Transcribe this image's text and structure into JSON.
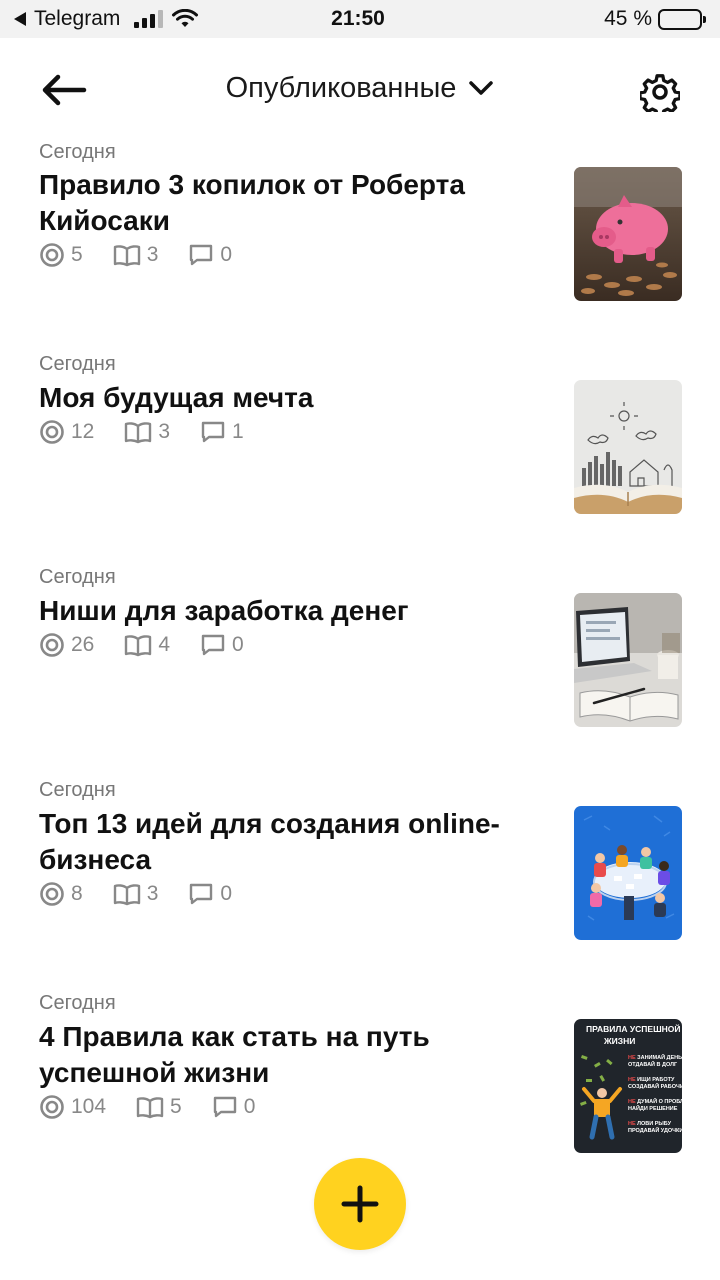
{
  "status_bar": {
    "back_app": "Telegram",
    "time": "21:50",
    "battery": "45 %",
    "battery_level": 0.45
  },
  "header": {
    "title": "Опубликованные"
  },
  "articles": [
    {
      "date": "Сегодня",
      "title": "Правило 3 копилок от Роберта Кийосаки",
      "views": "5",
      "reads": "3",
      "comments": "0",
      "thumb": "piggy-bank-image"
    },
    {
      "date": "Сегодня",
      "title": "Моя будущая мечта",
      "views": "12",
      "reads": "3",
      "comments": "1",
      "thumb": "book-sketch-image"
    },
    {
      "date": "Сегодня",
      "title": "Ниши для заработка денег",
      "views": "26",
      "reads": "4",
      "comments": "0",
      "thumb": "laptop-desk-image"
    },
    {
      "date": "Сегодня",
      "title": "Топ 13 идей для создания online-бизнеса",
      "views": "8",
      "reads": "3",
      "comments": "0",
      "thumb": "team-meeting-image"
    },
    {
      "date": "Сегодня",
      "title": "4 Правила как стать на путь успешной жизни",
      "views": "104",
      "reads": "5",
      "comments": "0",
      "thumb": "success-rules-image",
      "thumb_text": {
        "heading": "ПРАВИЛА УСПЕШНОЙ ЖИЗНИ",
        "lines": [
          "НЕ ЗАНИМАЙ ДЕНЬГИ ОТДАВАЙ В ДОЛГ",
          "НЕ ИЩИ РАБОТУ СОЗДАВАЙ РАБОЧИЕ",
          "НЕ ДУМАЙ О ПРОБЛЕМАХ НАЙДИ РЕШЕНИЕ",
          "НЕ ЛОВИ РЫБУ ПРОДАВАЙ УДОЧКИ"
        ]
      }
    }
  ],
  "colors": {
    "accent": "#ffd21f",
    "muted": "#888888"
  },
  "icons": {
    "views": "views-icon",
    "reads": "book-icon",
    "comments": "comment-icon",
    "add": "plus-icon"
  }
}
